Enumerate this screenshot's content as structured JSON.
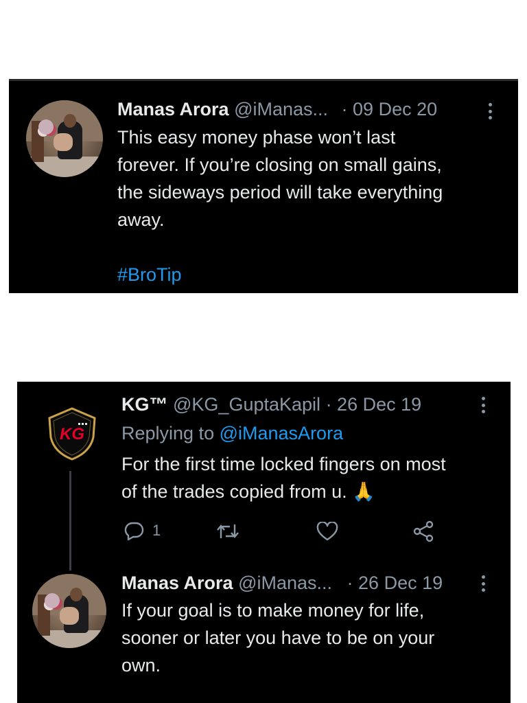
{
  "tweet1": {
    "name": "Manas Arora",
    "handle": "@iManas...",
    "date": "· 09 Dec 20",
    "lines": [
      "This easy money phase won’t last",
      "forever. If you’re closing on small gains,",
      "the sideways period will take everything",
      "away."
    ],
    "hashtag": "#BroTip"
  },
  "tweet2": {
    "name": "KG™",
    "handle": "@KG_GuptaKapil",
    "date": "· 26 Dec 19",
    "replying_prefix": "Replying to",
    "replying_handle": "@iManasArora",
    "logo_text": "KG",
    "lines": [
      "For the first time locked fingers on most",
      "of the trades copied from u. 🙏"
    ],
    "reply_count": "1",
    "icons": [
      "reply-icon",
      "retweet-icon",
      "like-icon",
      "share-icon"
    ]
  },
  "tweet3": {
    "name": "Manas Arora",
    "handle": "@iManas...",
    "date": "· 26 Dec 19",
    "lines": [
      "If your goal is to make money for life,",
      "sooner or later you have to be on your",
      "own."
    ]
  },
  "colors": {
    "background": "#000000",
    "text": "#e7e9ea",
    "muted": "#8b98a5",
    "link": "#1d9bf0",
    "logo_red": "#e4002b",
    "logo_gold": "#c9a24a"
  }
}
